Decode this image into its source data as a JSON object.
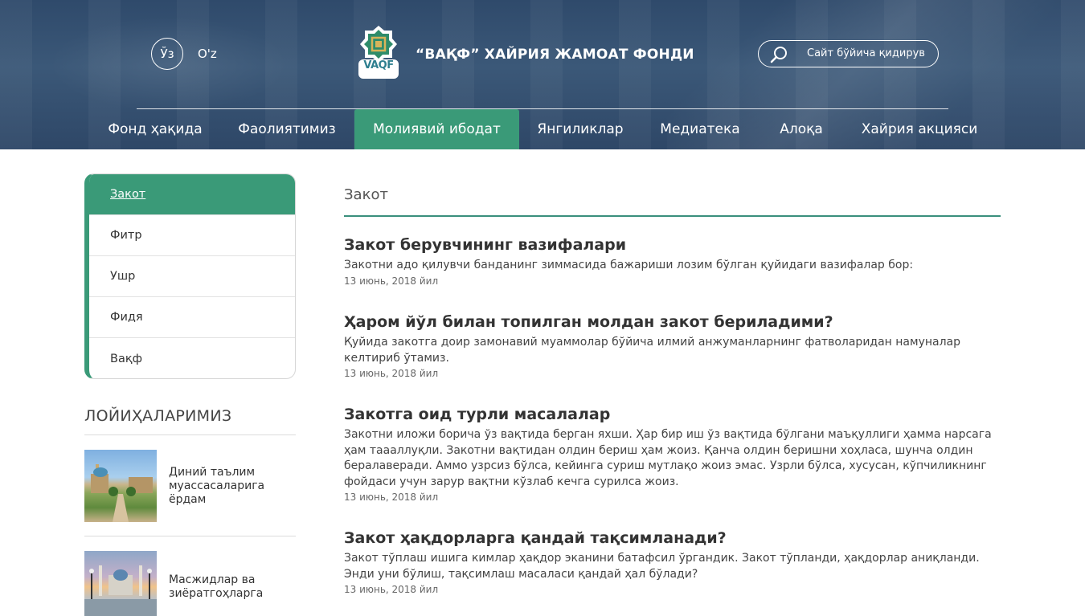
{
  "header": {
    "lang_cyrillic": "Ўз",
    "lang_latin": "O'z",
    "logo_text": "VAQF",
    "site_title": "“ВАҚФ” ХАЙРИЯ ЖАМОАТ ФОНДИ",
    "search_placeholder": "Сайт бўйича қидирув"
  },
  "nav": {
    "items": [
      {
        "label": "Фонд ҳақида"
      },
      {
        "label": "Фаолиятимиз"
      },
      {
        "label": "Молиявий ибодат",
        "active": true
      },
      {
        "label": "Янгиликлар"
      },
      {
        "label": "Медиатека"
      },
      {
        "label": "Алоқа"
      },
      {
        "label": "Хайрия акцияси"
      }
    ]
  },
  "sidebar": {
    "items": [
      {
        "label": "Закот",
        "active": true
      },
      {
        "label": "Фитр"
      },
      {
        "label": "Ушр"
      },
      {
        "label": "Фидя"
      },
      {
        "label": "Вақф"
      }
    ],
    "projects_title": "ЛОЙИҲАЛАРИМИЗ",
    "projects": [
      {
        "label": "Диний таълим муассасаларига ёрдам"
      },
      {
        "label": "Масжидлар ва зиёратгоҳларга"
      }
    ]
  },
  "main": {
    "title": "Закот",
    "articles": [
      {
        "title": "Закот берувчининг вазифалари",
        "desc": "Закотни адо қилувчи банданинг зиммасида бажариши лозим бўлган қуйидаги вазифалар бор:",
        "date": "13 июнь, 2018 йил"
      },
      {
        "title": "Ҳаром йўл билан топилган молдан закот бериладими?",
        "desc": "Қуйида закотга доир замонавий муаммолар бўйича илмий анжуманларнинг фатволаридан намуналар келтириб ўтамиз.",
        "date": "13 июнь, 2018 йил"
      },
      {
        "title": "Закотга оид турли масалалар",
        "desc": "Закотни иложи борича ўз вақтида берган яхши. Ҳар бир иш ўз вақтида бўлгани маъқуллиги ҳамма нарсага ҳам таааллуқли. Закотни вақтидан олдин бериш ҳам жоиз. Қанча олдин беришни хоҳласа, шунча олдин бералаверади. Аммо узрсиз бўлса, кейинга суриш мутлақо жоиз эмас. Узрли бўлса, хусусан, кўпчиликнинг фойдаси учун зарур вақтни кўзлаб кечга сурилса жоиз.",
        "date": "13 июнь, 2018 йил"
      },
      {
        "title": "Закот ҳақдорларга қандай тақсимланади?",
        "desc": "Закот тўплаш ишига кимлар ҳақдор эканини батафсил ўргандик. Закот тўпланди, ҳақдорлар аниқланди. Энди уни бўлиш, тақсимлаш масаласи қандай ҳал бўлади?",
        "date": "13 июнь, 2018 йил"
      }
    ]
  },
  "colors": {
    "accent": "#3a9a78",
    "header_bg": "#34506f"
  },
  "icons": [
    "search-icon",
    "vaqf-logo"
  ]
}
